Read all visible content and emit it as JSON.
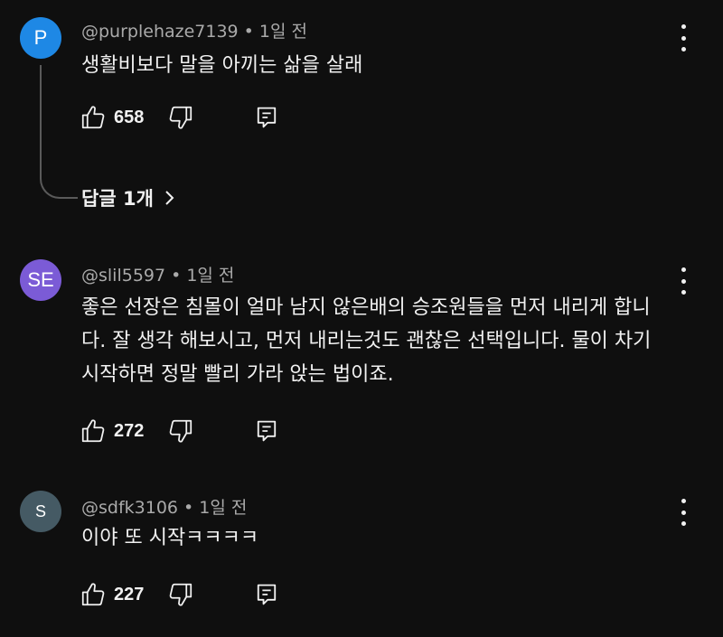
{
  "comments": [
    {
      "avatar_letter": "P",
      "avatar_color": "#1e88e5",
      "author": "@purplehaze7139",
      "time": "1일 전",
      "text": "생활비보다 말을 아끼는 삶을 살래",
      "likes": "658",
      "replies_label": "답글 1개"
    },
    {
      "avatar_letter": "SE",
      "avatar_color": "#7b5bd6",
      "author": "@slil5597",
      "time": "1일 전",
      "text": "좋은 선장은 침몰이 얼마 남지 않은배의 승조원들을 먼저 내리게 합니다. 잘 생각 해보시고, 먼저 내리는것도 괜찮은 선택입니다. 물이 차기 시작하면 정말 빨리 가라 앉는 법이죠.",
      "likes": "272"
    },
    {
      "avatar_letter": "S",
      "avatar_color": "#455a64",
      "author": "@sdfk3106",
      "time": "1일 전",
      "text": "이야 또 시작ㅋㅋㅋㅋ",
      "likes": "227"
    }
  ],
  "icons": {
    "like": "thumbs-up-icon",
    "dislike": "thumbs-down-icon",
    "reply": "reply-comment-icon",
    "more": "more-vertical-icon",
    "expand": "chevron-right-icon"
  }
}
